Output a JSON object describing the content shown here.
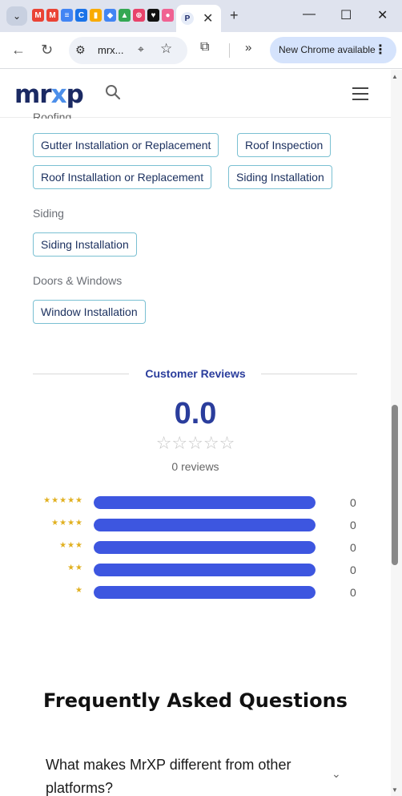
{
  "browser": {
    "tab_url": "mrx...",
    "update_label": "New Chrome available"
  },
  "colors": {
    "brand_dark": "#1b2a63",
    "brand_accent": "#4c8fea",
    "review_blue": "#2a3d9c",
    "bar_blue": "#3d56e0",
    "star_gold": "#e1b020",
    "chip_border": "#7ac0d2"
  },
  "site": {
    "logo_left": "mr",
    "logo_x": "x",
    "logo_right": "p"
  },
  "services": {
    "roofing_chips": [
      "Gutter Installation or Replacement",
      "Roof Inspection",
      "Roof Installation or Replacement",
      "Siding Installation"
    ],
    "siding_label": "Siding",
    "siding_chips": [
      "Siding Installation"
    ],
    "doors_label": "Doors & Windows",
    "doors_chips": [
      "Window Installation"
    ]
  },
  "reviews": {
    "title": "Customer Reviews",
    "score": "0.0",
    "count_text": "0 reviews",
    "breakdown": [
      {
        "stars": "★★★★★",
        "count": "0",
        "fraction": 0
      },
      {
        "stars": "★★★★",
        "count": "0",
        "fraction": 0
      },
      {
        "stars": "★★★",
        "count": "0",
        "fraction": 0
      },
      {
        "stars": "★★",
        "count": "0",
        "fraction": 0
      },
      {
        "stars": "★",
        "count": "0",
        "fraction": 0
      }
    ]
  },
  "faq": {
    "title": "Frequently Asked Questions",
    "first_question": "What makes MrXP different from other platforms?"
  }
}
